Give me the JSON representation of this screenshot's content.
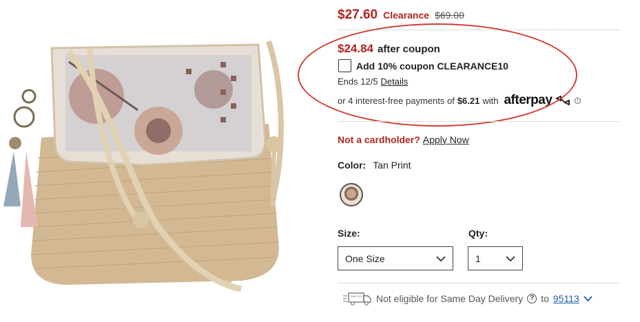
{
  "pricing": {
    "sale_price": "$27.60",
    "sale_tag": "Clearance",
    "original_price": "$69.00",
    "coupon_price": "$24.84",
    "after_coupon": "after coupon",
    "coupon_checkbox_label": "Add 10% coupon CLEARANCE10",
    "ends_text": "Ends 12/5",
    "details_link": "Details",
    "afterpay_prefix": "or 4 interest-free payments of",
    "afterpay_amount": "$6.21",
    "afterpay_with": "with",
    "afterpay_brand": "afterpay"
  },
  "cardholder": {
    "question": "Not a cardholder?",
    "apply_link": "Apply Now"
  },
  "color": {
    "label": "Color:",
    "value": "Tan Print"
  },
  "size": {
    "label": "Size:",
    "selected": "One Size"
  },
  "qty": {
    "label": "Qty:",
    "selected": "1"
  },
  "delivery": {
    "text": "Not eligible for Same Day Delivery",
    "to": "to",
    "zip": "95113",
    "truck_badge": "SAME DAY"
  },
  "colors": {
    "price_red": "#b0241d",
    "annotation_red": "#d23b32",
    "link_blue": "#1f5fa0"
  }
}
